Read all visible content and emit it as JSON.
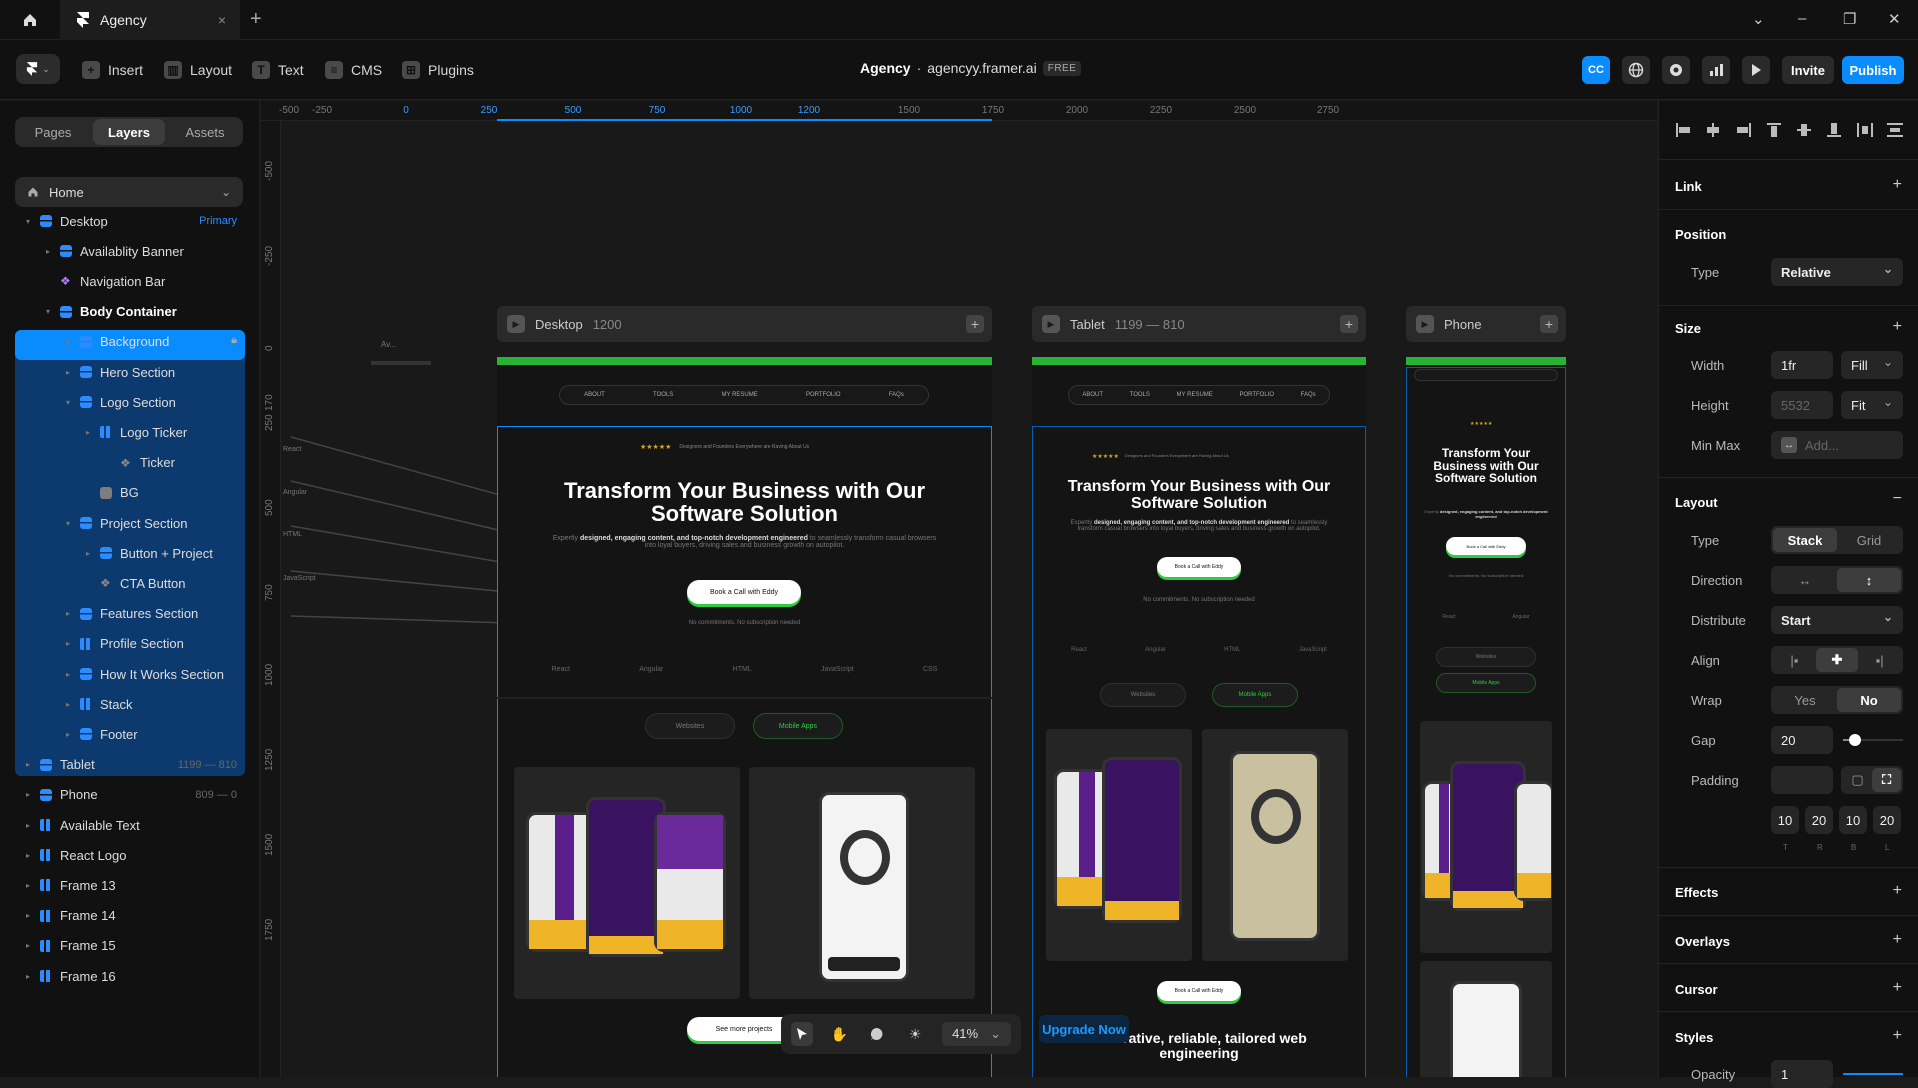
{
  "tabbar": {
    "tab_title": "Agency",
    "close_glyph": "×",
    "new_tab_glyph": "+",
    "window_controls": [
      "⌄",
      "–",
      "❐",
      "✕"
    ]
  },
  "toolbar": {
    "insert": "Insert",
    "layout": "Layout",
    "text": "Text",
    "cms": "CMS",
    "plugins": "Plugins",
    "project_name": "Agency",
    "separator": "·",
    "project_url": "agencyy.framer.ai",
    "plan_badge": "FREE",
    "avatar_initials": "CC",
    "invite": "Invite",
    "publish": "Publish"
  },
  "left": {
    "tabs": [
      "Pages",
      "Layers",
      "Assets"
    ],
    "active_tab": "Layers",
    "page_select": "Home",
    "layers": [
      {
        "label": "Desktop",
        "indent": 0,
        "icon": "frame",
        "badge": "Primary"
      },
      {
        "label": "Availablity Banner",
        "indent": 1,
        "icon": "frame"
      },
      {
        "label": "Navigation Bar",
        "indent": 1,
        "icon": "component"
      },
      {
        "label": "Body Container",
        "indent": 1,
        "icon": "frame",
        "selected": true
      },
      {
        "label": "Background",
        "indent": 2,
        "icon": "frame",
        "locked": true
      },
      {
        "label": "Hero Section",
        "indent": 2,
        "icon": "frame"
      },
      {
        "label": "Logo Section",
        "indent": 2,
        "icon": "frame"
      },
      {
        "label": "Logo Ticker",
        "indent": 3,
        "icon": "stack"
      },
      {
        "label": "Ticker",
        "indent": 4,
        "icon": "component"
      },
      {
        "label": "BG",
        "indent": 3,
        "icon": "grey"
      },
      {
        "label": "Project Section",
        "indent": 2,
        "icon": "frame"
      },
      {
        "label": "Button + Project",
        "indent": 3,
        "icon": "frame"
      },
      {
        "label": "CTA Button",
        "indent": 3,
        "icon": "component"
      },
      {
        "label": "Features Section",
        "indent": 2,
        "icon": "frame"
      },
      {
        "label": "Profile Section",
        "indent": 2,
        "icon": "stack"
      },
      {
        "label": "How It Works Section",
        "indent": 2,
        "icon": "frame"
      },
      {
        "label": "Stack",
        "indent": 2,
        "icon": "stack"
      },
      {
        "label": "Footer",
        "indent": 2,
        "icon": "frame"
      },
      {
        "label": "Tablet",
        "indent": 0,
        "icon": "frame",
        "meta": "1199 — 810"
      },
      {
        "label": "Phone",
        "indent": 0,
        "icon": "frame",
        "meta": "809 — 0"
      },
      {
        "label": "Available Text",
        "indent": 0,
        "icon": "stack"
      },
      {
        "label": "React Logo",
        "indent": 0,
        "icon": "stack"
      },
      {
        "label": "Frame 13",
        "indent": 0,
        "icon": "stack"
      },
      {
        "label": "Frame 14",
        "indent": 0,
        "icon": "stack"
      },
      {
        "label": "Frame 15",
        "indent": 0,
        "icon": "stack"
      },
      {
        "label": "Frame 16",
        "indent": 0,
        "icon": "stack"
      }
    ]
  },
  "canvas": {
    "ruler_top": [
      "-500",
      "-250",
      "0",
      "250",
      "500",
      "750",
      "1000",
      "1200",
      "1500",
      "1750",
      "2000",
      "2250",
      "2500",
      "2750"
    ],
    "ruler_left": [
      "-500",
      "-250",
      "0",
      "170",
      "250",
      "500",
      "750",
      "1000",
      "1250",
      "1500",
      "1750"
    ],
    "frames": {
      "desktop": {
        "label": "Desktop",
        "size": "1200"
      },
      "tablet": {
        "label": "Tablet",
        "size": "1199 — 810"
      },
      "phone": {
        "label": "Phone",
        "size": ""
      }
    },
    "side_texts": [
      "Av...",
      "React",
      "Angular",
      "HTML",
      "JavaScript"
    ],
    "site": {
      "nav": [
        "ABOUT",
        "TOOLS",
        "MY RESUME",
        "PORTFOLIO",
        "FAQs"
      ],
      "trust_line": "Designers and Founders Everywhere are Raving About Us",
      "stars": "★★★★★",
      "hero_title": "Transform Your Business with Our Software Solution",
      "hero_sub_lead": "Expertly",
      "hero_sub_bold": "designed, engaging content, and top-notch development engineered",
      "hero_sub_tail": "to seamlessly transform casual browsers into loyal buyers, driving sales and business growth on autopilot.",
      "cta": "Book a Call with Eddy",
      "cta_note": "No commitments. No subscription needed",
      "tech": [
        "React",
        "Angular",
        "HTML",
        "JavaScript",
        "CSS"
      ],
      "chip_websites": "Websites",
      "chip_apps": "Mobile Apps",
      "see_more": "See more projects",
      "tablet_footer_title": "Innovative, reliable, tailored web engineering"
    },
    "zoom": "41%",
    "upgrade": "Upgrade Now"
  },
  "right": {
    "link": "Link",
    "position": "Position",
    "pos_type_label": "Type",
    "pos_type": "Relative",
    "size": "Size",
    "width_label": "Width",
    "width_val": "1fr",
    "width_mode": "Fill",
    "height_label": "Height",
    "height_val": "5532",
    "height_mode": "Fit",
    "minmax_label": "Min Max",
    "minmax_ph": "Add...",
    "layout": "Layout",
    "layout_type_label": "Type",
    "layout_types": [
      "Stack",
      "Grid"
    ],
    "direction_label": "Direction",
    "distribute_label": "Distribute",
    "distribute": "Start",
    "align_label": "Align",
    "wrap_label": "Wrap",
    "wrap_opts": [
      "Yes",
      "No"
    ],
    "gap_label": "Gap",
    "gap": "20",
    "gap_slider": 0.2,
    "padding_label": "Padding",
    "padding": [
      "10",
      "20",
      "10",
      "20"
    ],
    "padding_sides": [
      "T",
      "R",
      "B",
      "L"
    ],
    "effects": "Effects",
    "overlays": "Overlays",
    "cursor": "Cursor",
    "styles": "Styles",
    "opacity_label": "Opacity",
    "opacity": "1"
  },
  "colors": {
    "accent": "#0a8cff",
    "banner_green": "#26b336",
    "selection_bg": "#0d3a6e",
    "publish": "#0a8cff"
  }
}
